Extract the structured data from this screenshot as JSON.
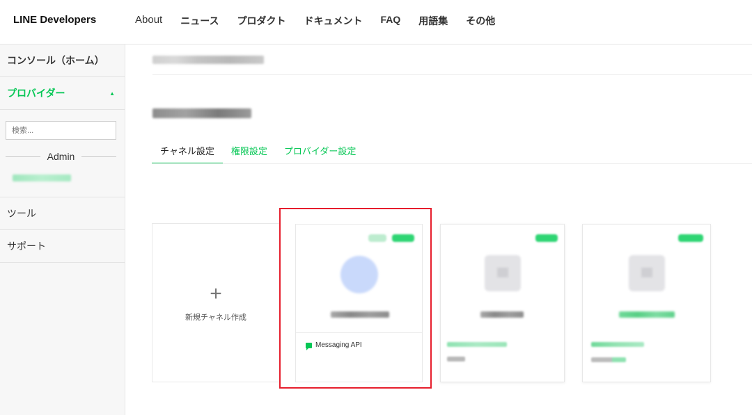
{
  "header": {
    "brand": "LINE Developers",
    "nav": [
      "About",
      "ニュース",
      "プロダクト",
      "ドキュメント",
      "FAQ",
      "用語集",
      "その他"
    ]
  },
  "sidebar": {
    "home": "コンソール（ホーム）",
    "provider": "プロバイダー",
    "search_placeholder": "検索...",
    "admin_label": "Admin",
    "tools": "ツール",
    "support": "サポート"
  },
  "tabs": [
    "チャネル設定",
    "権限設定",
    "プロバイダー設定"
  ],
  "new_channel_label": "新規チャネル作成",
  "channel_type": "Messaging API",
  "colors": {
    "accent": "#06c755",
    "highlight": "#e61e2d"
  },
  "icons": {
    "plus": "plus-icon",
    "message": "message-bubble-icon",
    "caret": "caret-up-icon"
  }
}
